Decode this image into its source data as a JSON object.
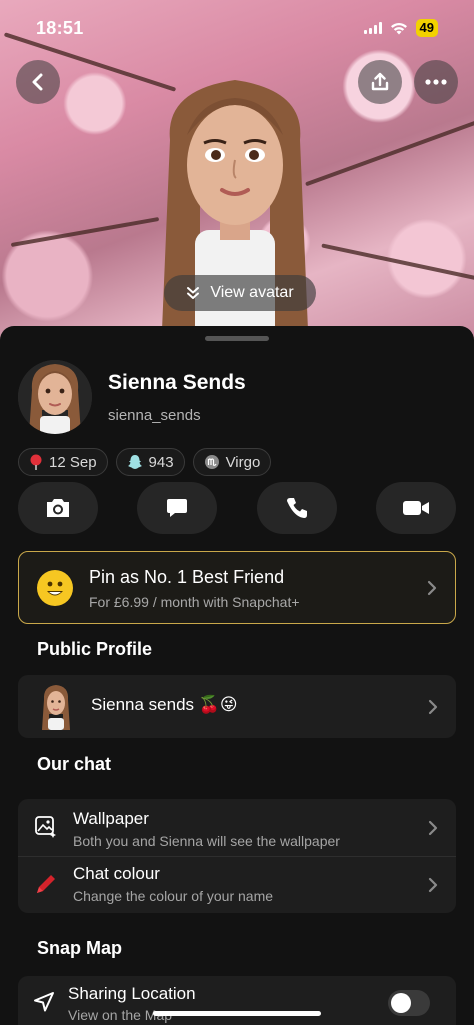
{
  "status_bar": {
    "time": "18:51",
    "battery": "49"
  },
  "hero": {
    "view_avatar_label": "View avatar"
  },
  "profile": {
    "name": "Sienna Sends",
    "username": "sienna_sends"
  },
  "chips": [
    {
      "icon": "red-pin-icon",
      "label": "12 Sep"
    },
    {
      "icon": "snapchat-ghost-icon",
      "label": "943"
    },
    {
      "icon": "virgo-zodiac-icon",
      "label": "Virgo"
    }
  ],
  "actions": [
    "camera-icon",
    "chat-icon",
    "phone-icon",
    "video-icon"
  ],
  "pin_card": {
    "title": "Pin as No. 1 Best Friend",
    "subtitle": "For £6.99 / month with Snapchat+",
    "accent": "#c9a84a"
  },
  "public_profile": {
    "section_title": "Public Profile",
    "label": "Sienna sends 🍒😜"
  },
  "our_chat": {
    "section_title": "Our chat",
    "wallpaper_title": "Wallpaper",
    "wallpaper_sub": "Both you and Sienna will see the wallpaper",
    "chat_colour_title": "Chat colour",
    "chat_colour_sub": "Change the colour of your name"
  },
  "snap_map": {
    "section_title": "Snap Map",
    "sharing_title": "Sharing Location",
    "sharing_sub": "View on the Map",
    "sharing_enabled": false
  }
}
